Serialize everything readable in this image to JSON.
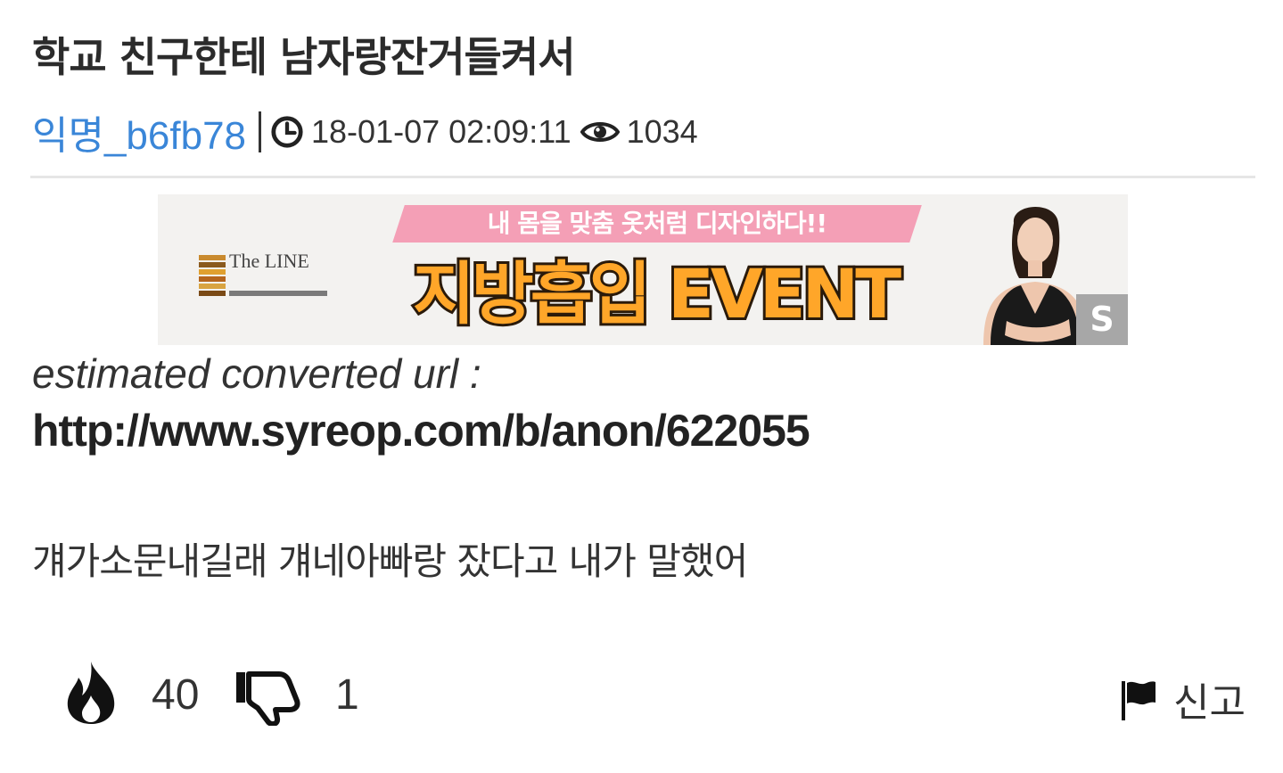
{
  "post": {
    "title": "학교 친구한테 남자랑잔거들켜서",
    "author": "익명_b6fb78",
    "datetime": "18-01-07 02:09:11",
    "views": "1034",
    "estimated_label": "estimated converted url :",
    "url": "http://www.syreop.com/b/anon/622055",
    "body": "걔가소문내길래 걔네아빠랑 잤다고 내가 말했어"
  },
  "ad": {
    "tagline": "내 몸을 맞춤 옷처럼 디자인하다!!",
    "headline": "지방흡입 EVENT",
    "logo_text": "The LINE",
    "badge": "S"
  },
  "actions": {
    "likes": "40",
    "dislikes": "1",
    "report_label": "신고"
  },
  "colors": {
    "author_link": "#3a86d8",
    "banner_pink": "#f49fb6",
    "banner_orange": "#ffa629"
  },
  "icons": [
    "clock-icon",
    "eye-icon",
    "fire-icon",
    "thumbs-down-icon",
    "flag-icon"
  ]
}
